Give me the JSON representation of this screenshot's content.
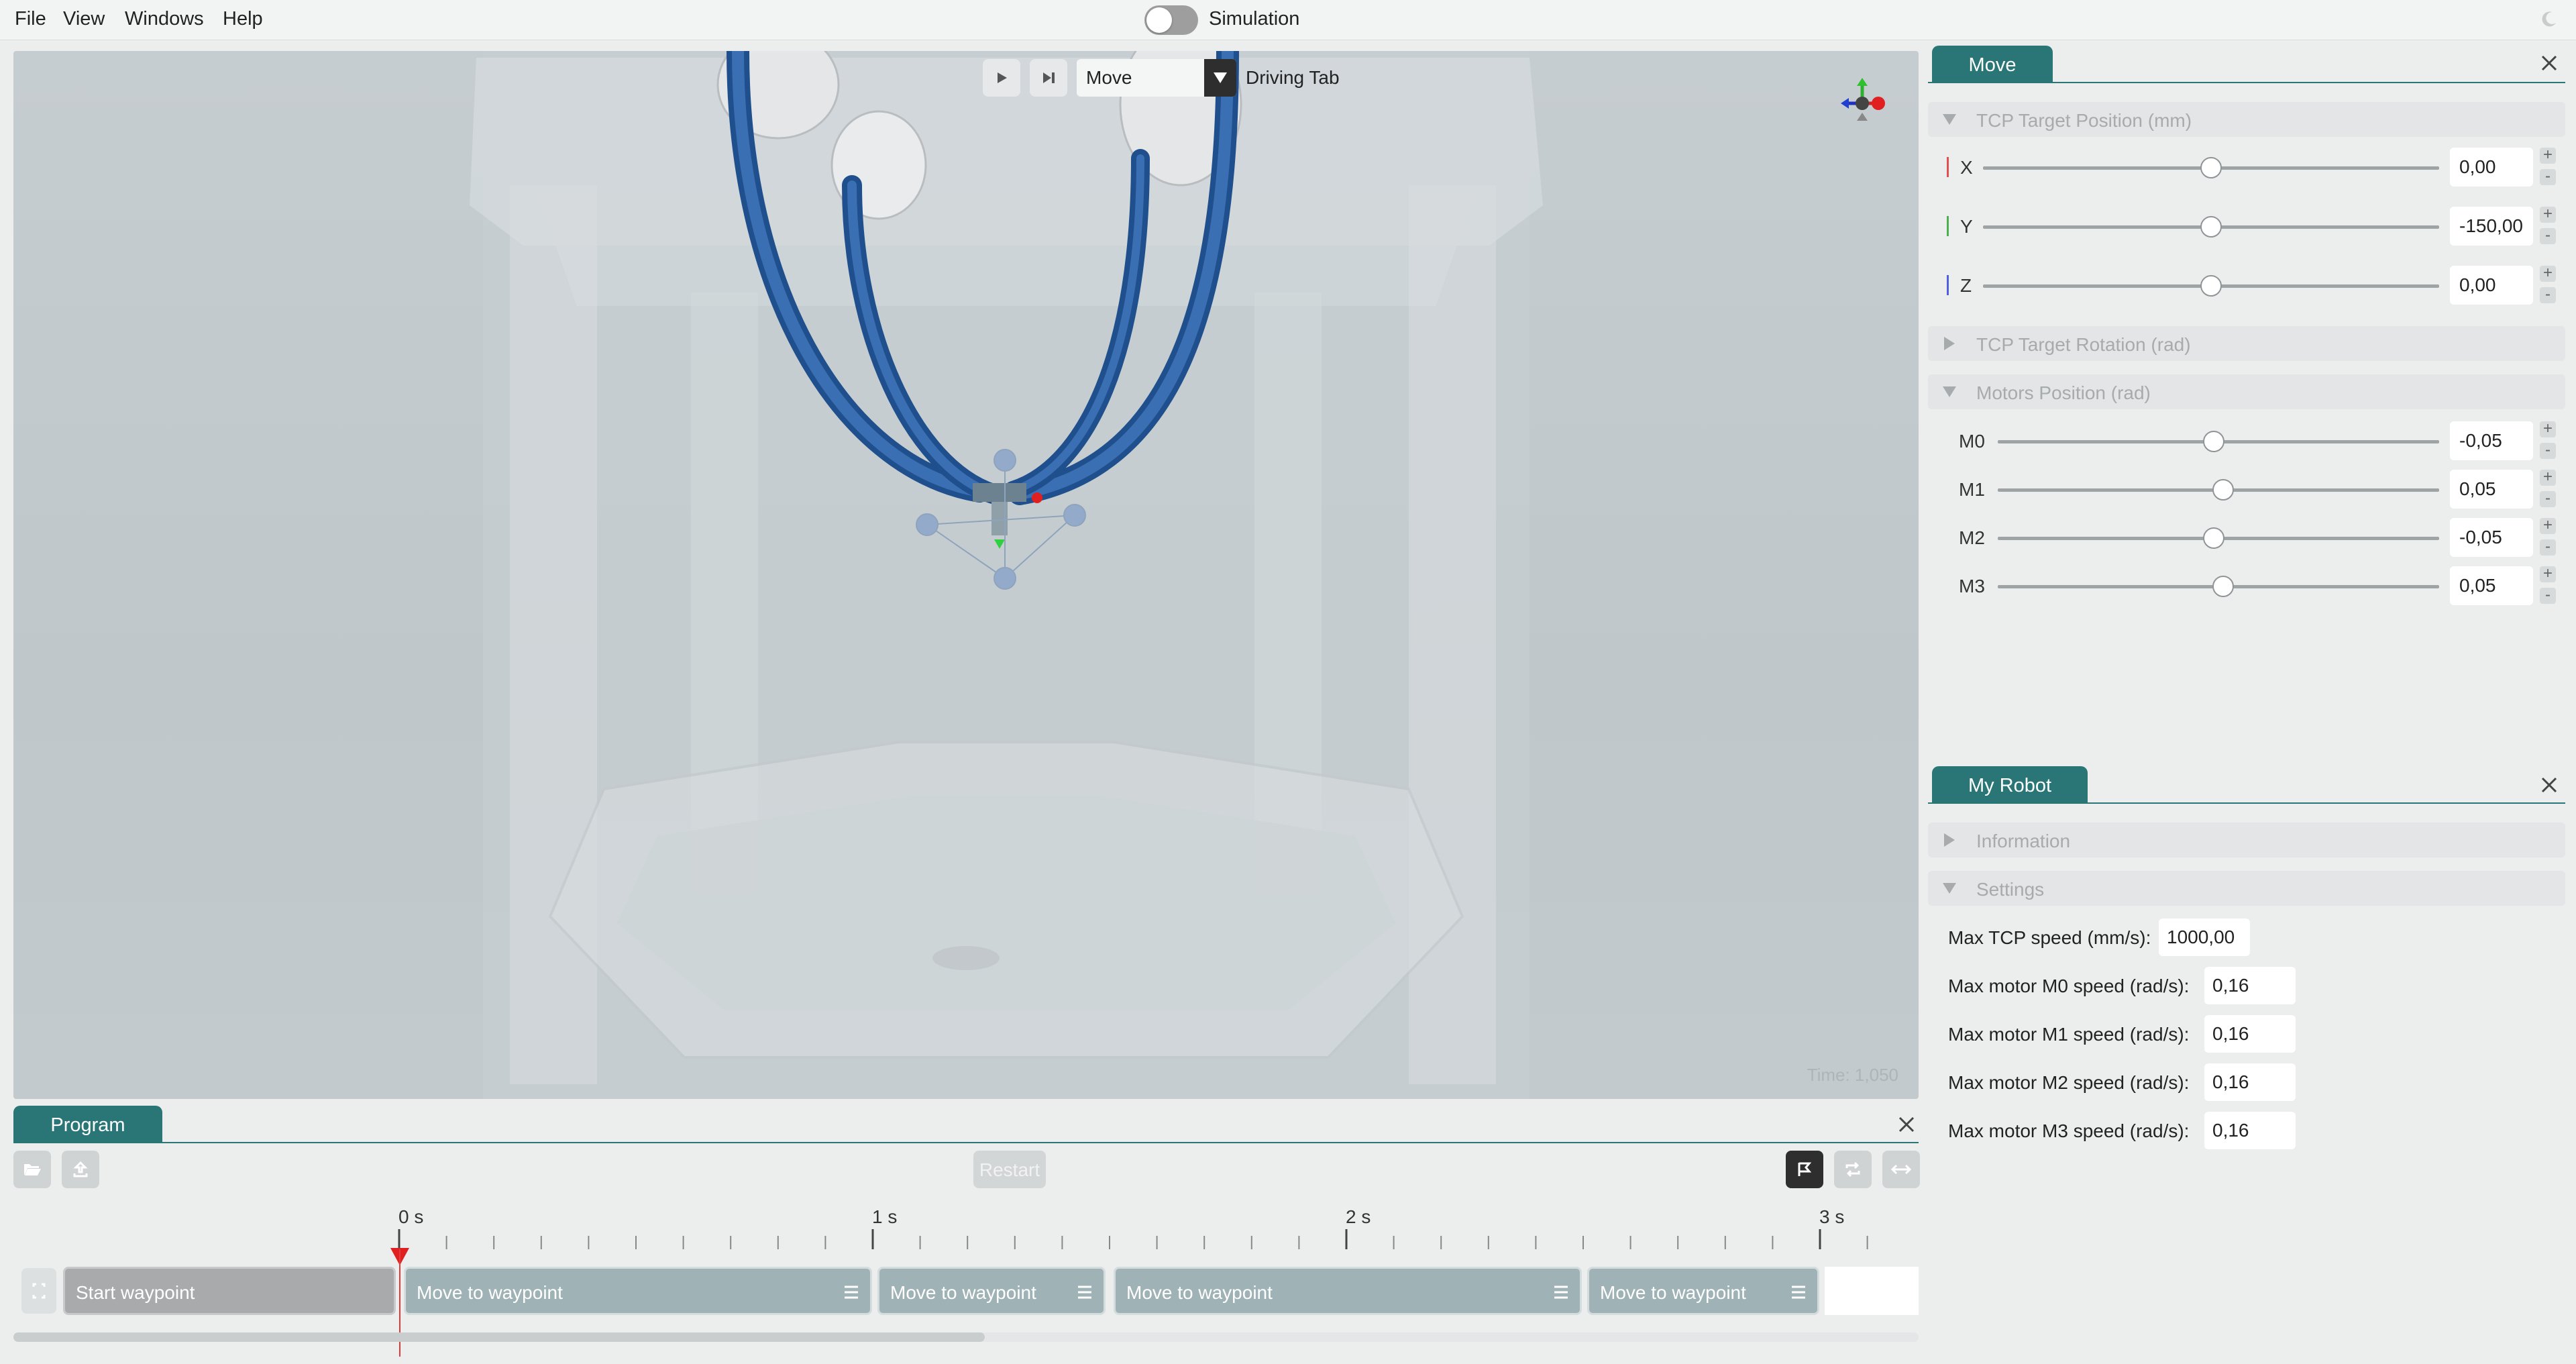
{
  "menubar": {
    "items": [
      "File",
      "View",
      "Windows",
      "Help"
    ],
    "simulation_label": "Simulation"
  },
  "viewport": {
    "mode": "Move",
    "driving_tab": "Driving Tab",
    "time": "Time: 1,050"
  },
  "move_panel": {
    "tab": "Move",
    "sections": {
      "tcp_position": "TCP Target Position (mm)",
      "tcp_rotation": "TCP Target Rotation (rad)",
      "motors": "Motors Position (rad)"
    },
    "axes": [
      {
        "label": "X",
        "value": "0,00",
        "color": "#e05050",
        "level": 0.5
      },
      {
        "label": "Y",
        "value": "-150,00",
        "color": "#4caf50",
        "level": 0.5
      },
      {
        "label": "Z",
        "value": "0,00",
        "color": "#5060e0",
        "level": 0.5
      }
    ],
    "motors": [
      {
        "label": "M0",
        "value": "-0,05",
        "level": 0.49
      },
      {
        "label": "M1",
        "value": "0,05",
        "level": 0.51
      },
      {
        "label": "M2",
        "value": "-0,05",
        "level": 0.49
      },
      {
        "label": "M3",
        "value": "0,05",
        "level": 0.51
      }
    ],
    "plus": "+",
    "minus": "-"
  },
  "robot_panel": {
    "tab": "My Robot",
    "sections": {
      "information": "Information",
      "settings": "Settings"
    },
    "settings": [
      {
        "label": "Max TCP speed (mm/s):",
        "value": "1000,00"
      },
      {
        "label": "Max motor M0 speed (rad/s):",
        "value": "0,16"
      },
      {
        "label": "Max motor M1 speed (rad/s):",
        "value": "0,16"
      },
      {
        "label": "Max motor M2 speed (rad/s):",
        "value": "0,16"
      },
      {
        "label": "Max motor M3 speed (rad/s):",
        "value": "0,16"
      }
    ]
  },
  "program_panel": {
    "tab": "Program",
    "restart_label": "Restart",
    "timeline": {
      "ticks": [
        "0 s",
        "1 s",
        "2 s",
        "3 s"
      ],
      "blocks": [
        {
          "label": "Start waypoint"
        },
        {
          "label": "Move to waypoint"
        },
        {
          "label": "Move to waypoint"
        },
        {
          "label": "Move to waypoint"
        },
        {
          "label": "Move to waypoint"
        }
      ]
    }
  }
}
